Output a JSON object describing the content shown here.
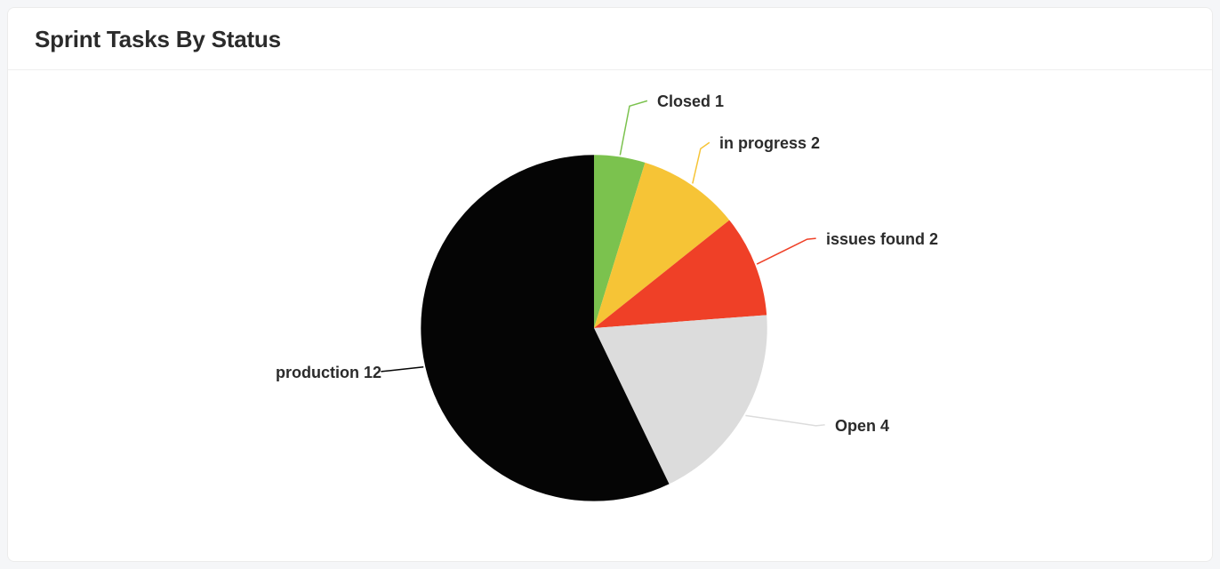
{
  "card": {
    "title": "Sprint Tasks By Status"
  },
  "chart_data": {
    "type": "pie",
    "title": "Sprint Tasks By Status",
    "series": [
      {
        "name": "Closed",
        "value": 1,
        "color": "#7bc24e"
      },
      {
        "name": "in progress",
        "value": 2,
        "color": "#f6c436"
      },
      {
        "name": "issues found",
        "value": 2,
        "color": "#ef4027"
      },
      {
        "name": "Open",
        "value": 4,
        "color": "#dcdcdc"
      },
      {
        "name": "production",
        "value": 12,
        "color": "#050505"
      }
    ],
    "label_leader_color": {
      "default": "slice"
    },
    "label_format": "{name} {value}"
  }
}
